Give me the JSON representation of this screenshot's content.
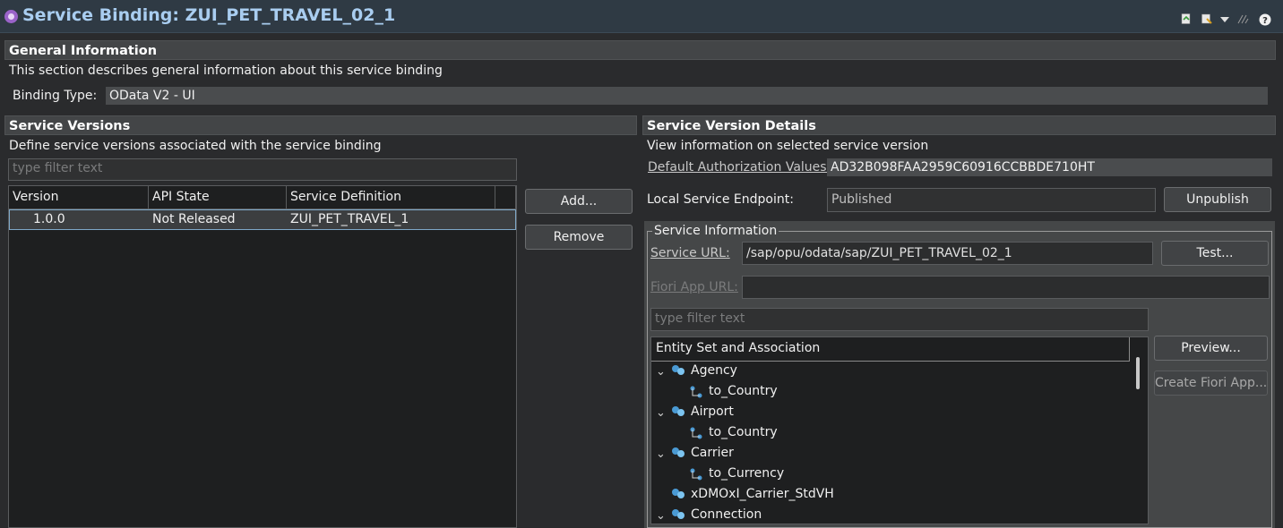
{
  "editor": {
    "title": "Service Binding: ZUI_PET_TRAVEL_02_1"
  },
  "general": {
    "header": "General Information",
    "description": "This section describes general information about this service binding",
    "binding_type_label": "Binding Type:",
    "binding_type_value": "OData V2 - UI"
  },
  "versions": {
    "header": "Service Versions",
    "description": "Define service versions associated with the service binding",
    "filter_placeholder": "type filter text",
    "columns": [
      "Version",
      "API State",
      "Service Definition"
    ],
    "rows": [
      {
        "version": "1.0.0",
        "api_state": "Not Released",
        "service_definition": "ZUI_PET_TRAVEL_1"
      }
    ],
    "add_label": "Add...",
    "remove_label": "Remove"
  },
  "details": {
    "header": "Service Version Details",
    "description": "View information on selected service version",
    "auth_label": "Default Authorization Values:",
    "auth_value": "AD32B098FAA2959C60916CCBBDE710HT",
    "endpoint_label": "Local Service Endpoint:",
    "endpoint_value": "Published",
    "unpublish_label": "Unpublish",
    "service_info": {
      "group_label": "Service Information",
      "url_label": "Service URL:",
      "url_value": "/sap/opu/odata/sap/ZUI_PET_TRAVEL_02_1",
      "test_label": "Test...",
      "fiori_label": "Fiori App URL:",
      "fiori_value": "",
      "filter_placeholder": "type filter text",
      "tree_header": "Entity Set and Association",
      "preview_label": "Preview...",
      "create_fiori_label": "Create Fiori App...",
      "tree": [
        {
          "label": "Agency",
          "type": "entity",
          "expanded": true
        },
        {
          "label": "to_Country",
          "type": "association"
        },
        {
          "label": "Airport",
          "type": "entity",
          "expanded": true
        },
        {
          "label": "to_Country",
          "type": "association"
        },
        {
          "label": "Carrier",
          "type": "entity",
          "expanded": true
        },
        {
          "label": "to_Currency",
          "type": "association"
        },
        {
          "label": "xDMOxI_Carrier_StdVH",
          "type": "entity"
        },
        {
          "label": "Connection",
          "type": "entity",
          "expanded": true
        }
      ]
    }
  },
  "colors": {
    "title": "#a9cdf0",
    "background": "#2a2b2d",
    "section_header": "#434547",
    "selection_border": "#7fa8c8"
  }
}
